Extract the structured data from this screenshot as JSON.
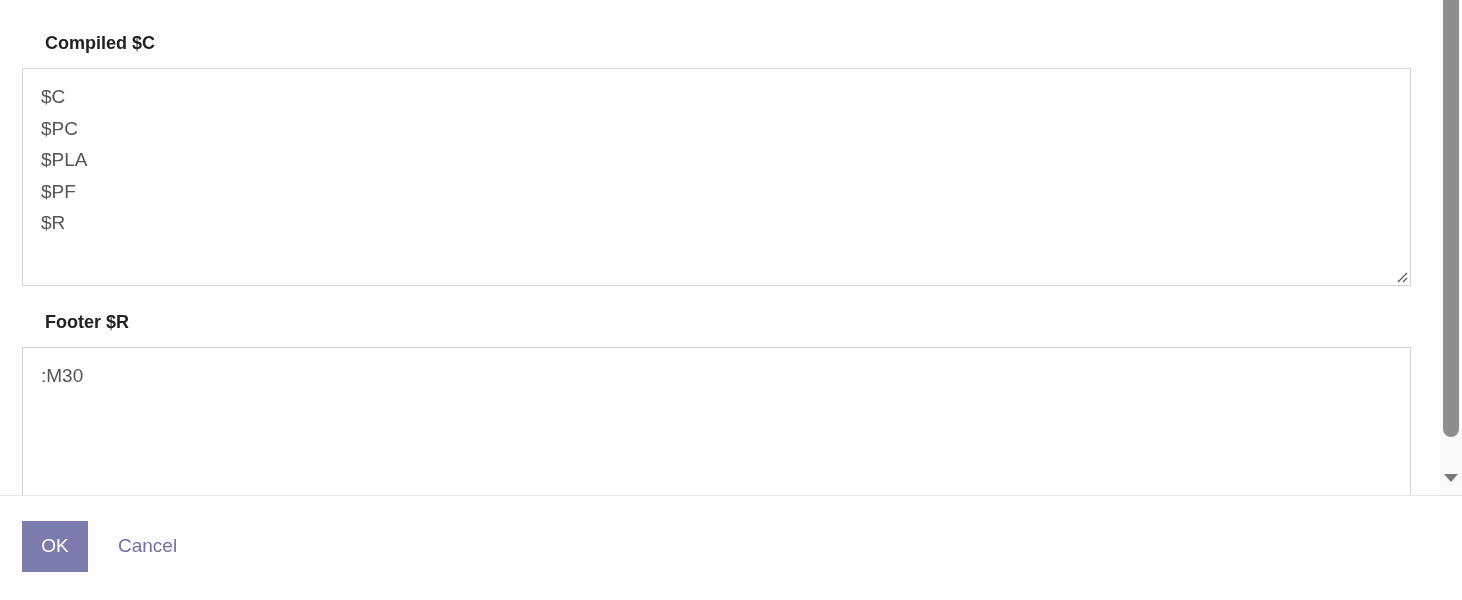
{
  "fields": [
    {
      "label": "Compiled $C",
      "lines": [
        "$C",
        "$PC",
        "$PLA",
        "$PF",
        "$R"
      ]
    },
    {
      "label": "Footer $R",
      "lines": [
        ":M30"
      ]
    }
  ],
  "buttons": [
    {
      "kind": "primary",
      "label": "OK"
    },
    {
      "kind": "link",
      "label": "Cancel"
    }
  ]
}
